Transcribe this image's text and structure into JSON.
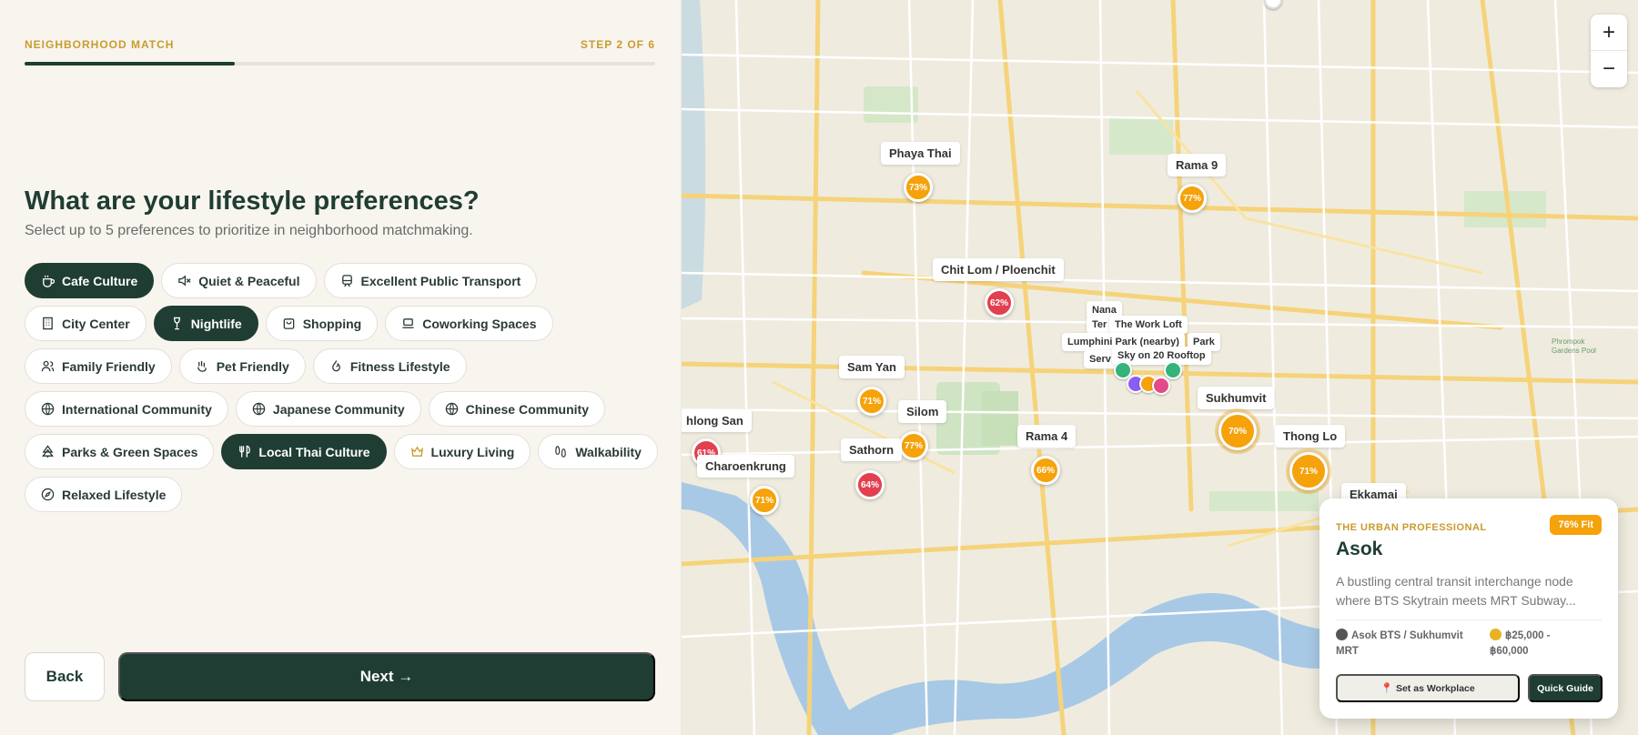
{
  "header": {
    "section_label": "NEIGHBORHOOD MATCH",
    "step_label": "STEP 2 OF 6",
    "progress": 0.333
  },
  "question": {
    "title": "What are your lifestyle preferences?",
    "subtitle": "Select up to 5 preferences to prioritize in neighborhood matchmaking."
  },
  "preferences": [
    {
      "label": "Cafe Culture",
      "icon": "coffee-icon",
      "selected": true
    },
    {
      "label": "Quiet & Peaceful",
      "icon": "volume-off-icon",
      "selected": false
    },
    {
      "label": "Excellent Public Transport",
      "icon": "train-icon",
      "selected": false
    },
    {
      "label": "City Center",
      "icon": "building-icon",
      "selected": false
    },
    {
      "label": "Nightlife",
      "icon": "wine-icon",
      "selected": true
    },
    {
      "label": "Shopping",
      "icon": "shopping-bag-icon",
      "selected": false
    },
    {
      "label": "Coworking Spaces",
      "icon": "laptop-icon",
      "selected": false
    },
    {
      "label": "Family Friendly",
      "icon": "users-icon",
      "selected": false
    },
    {
      "label": "Pet Friendly",
      "icon": "paw-icon",
      "selected": false
    },
    {
      "label": "Fitness Lifestyle",
      "icon": "flame-icon",
      "selected": false
    },
    {
      "label": "International Community",
      "icon": "globe-icon",
      "selected": false
    },
    {
      "label": "Japanese Community",
      "icon": "globe-icon",
      "selected": false
    },
    {
      "label": "Chinese Community",
      "icon": "globe-icon",
      "selected": false
    },
    {
      "label": "Parks & Green Spaces",
      "icon": "tree-icon",
      "selected": false
    },
    {
      "label": "Local Thai Culture",
      "icon": "utensils-icon",
      "selected": true
    },
    {
      "label": "Luxury Living",
      "icon": "crown-icon",
      "selected": false
    },
    {
      "label": "Walkability",
      "icon": "footprints-icon",
      "selected": false
    },
    {
      "label": "Relaxed Lifestyle",
      "icon": "compass-icon",
      "selected": false
    }
  ],
  "nav": {
    "back_label": "Back",
    "next_label": "Next →"
  },
  "map": {
    "zoom_in": "+",
    "zoom_out": "−",
    "areas": [
      {
        "id": "phaya-thai",
        "name": "Phaya Thai",
        "score": "73%"
      },
      {
        "id": "rama-9",
        "name": "Rama 9",
        "score": "77%"
      },
      {
        "id": "chit-lom",
        "name": "Chit Lom / Ploenchit",
        "score": "62%"
      },
      {
        "id": "sam-yan",
        "name": "Sam Yan",
        "score": "71%"
      },
      {
        "id": "silom",
        "name": "Silom",
        "score": "77%"
      },
      {
        "id": "rama-4",
        "name": "Rama 4",
        "score": "66%"
      },
      {
        "id": "sukhumvit",
        "name": "Sukhumvit",
        "score": "70%"
      },
      {
        "id": "thong-lo",
        "name": "Thong Lo",
        "score": "71%"
      },
      {
        "id": "khao-san",
        "name": "hlong San",
        "score": "61%"
      },
      {
        "id": "charoenkrung",
        "name": "Charoenkrung",
        "score": "71%"
      },
      {
        "id": "sathorn",
        "name": "Sathorn",
        "score": "64%"
      },
      {
        "id": "ekkamai",
        "name": "Ekkamai",
        "score": ""
      }
    ],
    "pois": {
      "nana": "Nana",
      "terminal": "Ter",
      "work_loft": "The Work Loft",
      "lumphini": "Lumphini Park (nearby)",
      "park": "Park",
      "serv": "Serv",
      "sky": "Sky on 20 Rooftop"
    },
    "map_text": {
      "gardens": "Phrompok\nGardens Pool"
    }
  },
  "card": {
    "kicker": "THE URBAN PROFESSIONAL",
    "fit": "76% Fit",
    "name": "Asok",
    "description": "A bustling central transit interchange node where BTS Skytrain meets MRT Subway...",
    "transit": "Asok BTS / Sukhumvit MRT",
    "price": "฿25,000 - ฿60,000",
    "work_button": "Set as Workplace",
    "guide_button": "Quick Guide"
  },
  "colors": {
    "primary": "#1f3d33",
    "accent": "#c99b2e",
    "marker_orange": "#f5a20b",
    "marker_red": "#e2404f"
  }
}
